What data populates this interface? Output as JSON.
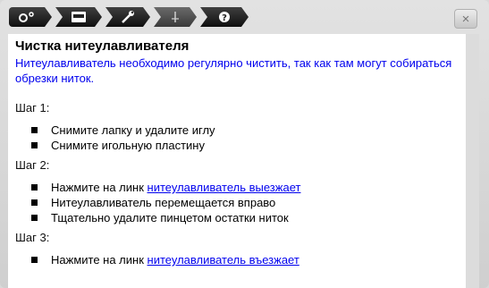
{
  "toolbar": {
    "items": [
      {
        "icon": "machine-settings-icon"
      },
      {
        "icon": "sewing-machine-icon"
      },
      {
        "icon": "wrench-icon"
      },
      {
        "icon": "needle-icon"
      },
      {
        "icon": "help-icon"
      }
    ]
  },
  "close_label": "×",
  "content": {
    "title": "Чистка нитеулавливателя",
    "intro": "Нитеулавливатель необходимо регулярно чистить, так как там могут собираться обрезки ниток.",
    "steps": [
      {
        "label": "Шаг 1:",
        "items": [
          {
            "text": "Снимите лапку и удалите иглу"
          },
          {
            "text": "Снимите игольную пластину"
          }
        ]
      },
      {
        "label": "Шаг 2:",
        "items": [
          {
            "prefix": "Нажмите на линк ",
            "link": "нитеулавливатель выезжает"
          },
          {
            "text": "Нитеулавливатель перемещается вправо"
          },
          {
            "text": "Тщательно удалите пинцетом остатки ниток"
          }
        ]
      },
      {
        "label": "Шаг 3:",
        "items": [
          {
            "prefix": "Нажмите на линк ",
            "link": "нитеулавливатель въезжает"
          }
        ]
      }
    ]
  }
}
